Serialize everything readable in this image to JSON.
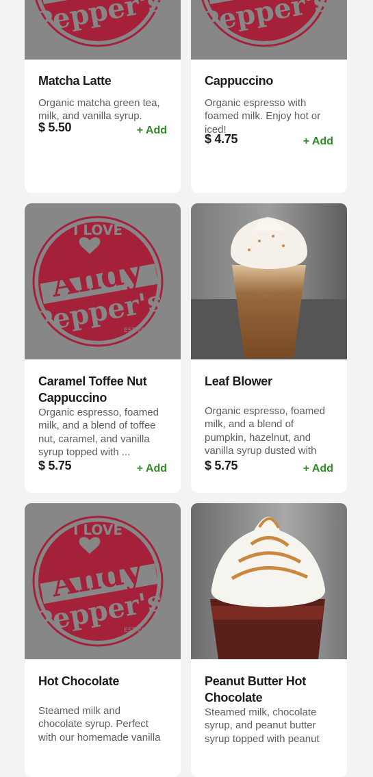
{
  "products": [
    {
      "name": "Matcha Latte",
      "description": "Organic matcha green tea, milk, and vanilla syrup.",
      "price": "$ 5.50",
      "add_label": "+ Add"
    },
    {
      "name": "Cappuccino",
      "description": "Organic espresso with foamed milk. Enjoy hot or iced!",
      "price": "$ 4.75",
      "add_label": "+ Add"
    },
    {
      "name": "Caramel Toffee Nut Cappuccino",
      "description": "Organic espresso, foamed milk, and a blend of toffee nut, caramel, and vanilla syrup topped with ...",
      "price": "$ 5.75",
      "add_label": "+ Add"
    },
    {
      "name": "Leaf Blower",
      "description": "Organic espresso, foamed milk, and a blend of pumpkin, hazelnut, and vanilla syrup dusted with",
      "price": "$ 5.75",
      "add_label": "+ Add"
    },
    {
      "name": "Hot Chocolate",
      "description": "Steamed milk and chocolate syrup. Perfect with our homemade vanilla",
      "price": "",
      "add_label": ""
    },
    {
      "name": "Peanut Butter Hot Chocolate",
      "description": "Steamed milk, chocolate syrup, and peanut butter syrup topped with peanut",
      "price": "",
      "add_label": ""
    }
  ],
  "logo": {
    "line1": "I LOVE",
    "line2": "Andy",
    "line3": "Pepper's",
    "est": "EST 2007"
  },
  "colors": {
    "brand": "#a5213a",
    "add": "#2e8b26",
    "placeholder": "#878787"
  }
}
